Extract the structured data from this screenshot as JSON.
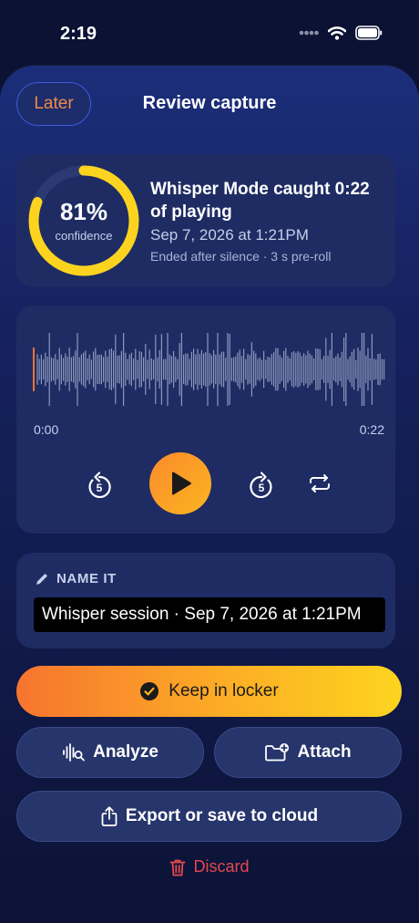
{
  "status_bar": {
    "time": "2:19"
  },
  "header": {
    "later_label": "Later",
    "title": "Review capture"
  },
  "capture": {
    "confidence_pct": "81%",
    "confidence_value": 0.81,
    "confidence_label": "confidence",
    "title": "Whisper Mode caught 0:22 of playing",
    "date": "Sep 7, 2026 at 1:21PM",
    "meta": "Ended after silence · 3 s pre-roll"
  },
  "player": {
    "time_start": "0:00",
    "time_end": "0:22",
    "skip_back_seconds": "5",
    "skip_forward_seconds": "5"
  },
  "name_section": {
    "label": "NAME IT",
    "value": "Whisper session · Sep 7, 2026 at 1:21PM"
  },
  "actions": {
    "keep_label": "Keep in locker",
    "analyze_label": "Analyze",
    "attach_label": "Attach",
    "export_label": "Export or save to cloud",
    "discard_label": "Discard"
  },
  "colors": {
    "accent_orange": "#f7742f",
    "accent_yellow": "#fcd41f",
    "danger": "#e5484d",
    "ring_track": "#2b3a73"
  }
}
